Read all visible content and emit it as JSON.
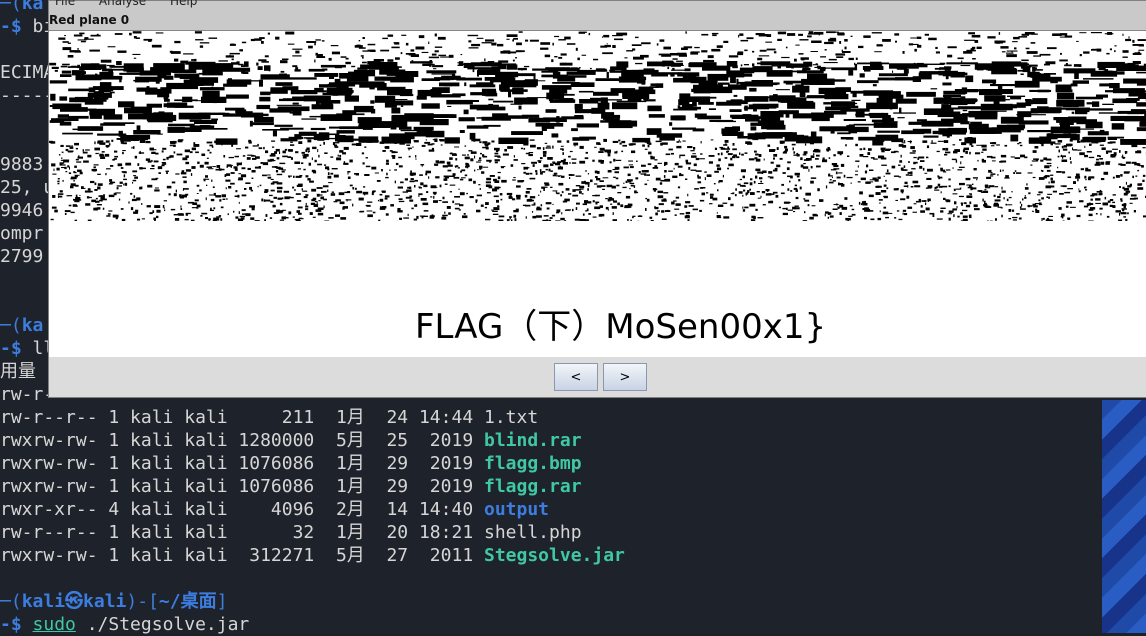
{
  "terminal": {
    "lines": [
      {
        "parts": [
          {
            "t": "─(",
            "c": "prompt-dim"
          },
          {
            "t": "ka",
            "c": "prompt-user"
          }
        ]
      },
      {
        "parts": [
          {
            "t": "-$ ",
            "c": "prompt-dollar"
          },
          {
            "t": "bi",
            "c": ""
          }
        ]
      },
      {
        "parts": [
          {
            "t": "",
            "c": ""
          }
        ]
      },
      {
        "parts": [
          {
            "t": "ECIMA",
            "c": ""
          }
        ]
      },
      {
        "parts": [
          {
            "t": "-----",
            "c": ""
          }
        ]
      },
      {
        "parts": [
          {
            "t": "",
            "c": ""
          }
        ]
      },
      {
        "parts": [
          {
            "t": "9883",
            "c": ""
          }
        ]
      },
      {
        "parts": [
          {
            "t": "25, u",
            "c": ""
          }
        ]
      },
      {
        "parts": [
          {
            "t": "9946",
            "c": ""
          }
        ]
      },
      {
        "parts": [
          {
            "t": "ompr",
            "c": ""
          }
        ]
      },
      {
        "parts": [
          {
            "t": "2799",
            "c": ""
          }
        ]
      },
      {
        "parts": [
          {
            "t": "",
            "c": ""
          }
        ]
      },
      {
        "parts": [
          {
            "t": "",
            "c": ""
          }
        ]
      },
      {
        "parts": [
          {
            "t": "─(",
            "c": "prompt-dim"
          },
          {
            "t": "ka",
            "c": "prompt-user"
          }
        ]
      },
      {
        "parts": [
          {
            "t": "-$ ",
            "c": "prompt-dollar"
          },
          {
            "t": "ll",
            "c": ""
          }
        ]
      },
      {
        "parts": [
          {
            "t": "用量",
            "c": ""
          }
        ]
      },
      {
        "parts": [
          {
            "t": "rw-r-",
            "c": ""
          }
        ]
      },
      {
        "parts": [
          {
            "t": "rw-r--r-- 1 kali kali     211  1月  24 14:44 ",
            "c": ""
          },
          {
            "t": "1.txt",
            "c": ""
          }
        ]
      },
      {
        "parts": [
          {
            "t": "rwxrw-rw- 1 kali kali 1280000  5月  25  2019 ",
            "c": ""
          },
          {
            "t": "blind.rar",
            "c": "green-bold"
          }
        ]
      },
      {
        "parts": [
          {
            "t": "rwxrw-rw- 1 kali kali 1076086  1月  29  2019 ",
            "c": ""
          },
          {
            "t": "flagg.bmp",
            "c": "green-bold"
          }
        ]
      },
      {
        "parts": [
          {
            "t": "rwxrw-rw- 1 kali kali 1076086  1月  29  2019 ",
            "c": ""
          },
          {
            "t": "flagg.rar",
            "c": "green-bold"
          }
        ]
      },
      {
        "parts": [
          {
            "t": "rwxr-xr-- 4 kali kali    4096  2月  14 14:40 ",
            "c": ""
          },
          {
            "t": "output",
            "c": "blue-bold"
          }
        ]
      },
      {
        "parts": [
          {
            "t": "rw-r--r-- 1 kali kali      32  1月  20 18:21 ",
            "c": ""
          },
          {
            "t": "shell.php",
            "c": ""
          }
        ]
      },
      {
        "parts": [
          {
            "t": "rwxrw-rw- 1 kali kali  312271  5月  27  2011 ",
            "c": ""
          },
          {
            "t": "Stegsolve.jar",
            "c": "green-bold"
          }
        ]
      },
      {
        "parts": [
          {
            "t": "",
            "c": ""
          }
        ]
      },
      {
        "parts": [
          {
            "t": "─(",
            "c": "prompt-dim"
          },
          {
            "t": "kali㉿kali",
            "c": "prompt-user"
          },
          {
            "t": ")-[",
            "c": "prompt-dim"
          },
          {
            "t": "~/桌面",
            "c": "prompt-user"
          },
          {
            "t": "]",
            "c": "prompt-dim"
          }
        ]
      },
      {
        "parts": [
          {
            "t": "-$ ",
            "c": "prompt-dollar"
          },
          {
            "t": "sudo",
            "c": "underline"
          },
          {
            "t": " ./Stegsolve.jar",
            "c": ""
          }
        ]
      }
    ]
  },
  "stegsolve": {
    "menu": [
      "File",
      "Analyse",
      "Help"
    ],
    "plane_label": "Red plane 0",
    "flag_text": "FLAG（下）MoSen00x1}",
    "prev_label": "<",
    "next_label": ">"
  }
}
